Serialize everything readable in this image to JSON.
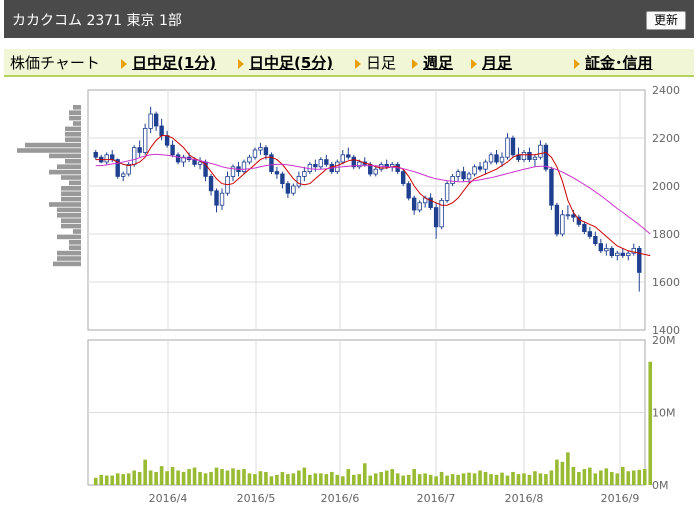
{
  "header": {
    "title": "カカクコム 2371 東京 1部",
    "update_label": "更新"
  },
  "nav": {
    "chart_label": "株価チャート",
    "items": [
      {
        "label": "日中足(1分)",
        "link": true
      },
      {
        "label": "日中足(5分)",
        "link": true
      },
      {
        "label": "日足",
        "link": false
      },
      {
        "label": "週足",
        "link": true
      },
      {
        "label": "月足",
        "link": true
      },
      {
        "label": "証金･信用",
        "link": true
      }
    ]
  },
  "chart_data": [
    {
      "type": "candlestick",
      "x_ticks": [
        "2016/4",
        "2016/5",
        "2016/6",
        "2016/7",
        "2016/8",
        "2016/9"
      ],
      "y_ticks": [
        "2400",
        "2200",
        "2000",
        "1800",
        "1600",
        "1400"
      ],
      "ylim": [
        1400,
        2400
      ],
      "grid": true,
      "colors": {
        "up": "#ffffff",
        "down": "#1f3f8f",
        "wick": "#1f3f8f",
        "ma_short": "#cc0000",
        "ma_long": "#cc33cc"
      },
      "series": [
        {
          "values": [
            [
              2140,
              2150,
              2110,
              2120
            ],
            [
              2120,
              2130,
              2095,
              2100
            ],
            [
              2100,
              2140,
              2090,
              2130
            ],
            [
              2130,
              2150,
              2100,
              2110
            ],
            [
              2110,
              2115,
              2030,
              2040
            ],
            [
              2040,
              2060,
              2020,
              2050
            ],
            [
              2050,
              2100,
              2040,
              2090
            ],
            [
              2090,
              2170,
              2080,
              2160
            ],
            [
              2160,
              2190,
              2120,
              2140
            ],
            [
              2140,
              2260,
              2130,
              2240
            ],
            [
              2240,
              2330,
              2220,
              2300
            ],
            [
              2300,
              2310,
              2230,
              2250
            ],
            [
              2250,
              2280,
              2190,
              2210
            ],
            [
              2210,
              2230,
              2160,
              2170
            ],
            [
              2170,
              2190,
              2120,
              2130
            ],
            [
              2130,
              2140,
              2090,
              2100
            ],
            [
              2100,
              2130,
              2080,
              2120
            ],
            [
              2120,
              2140,
              2100,
              2110
            ],
            [
              2110,
              2120,
              2080,
              2090
            ],
            [
              2090,
              2120,
              2070,
              2100
            ],
            [
              2100,
              2110,
              2020,
              2040
            ],
            [
              2040,
              2050,
              1960,
              1980
            ],
            [
              1980,
              1990,
              1890,
              1920
            ],
            [
              1920,
              1990,
              1900,
              1970
            ],
            [
              1970,
              2060,
              1960,
              2040
            ],
            [
              2040,
              2090,
              2020,
              2080
            ],
            [
              2080,
              2100,
              2040,
              2060
            ],
            [
              2060,
              2110,
              2050,
              2100
            ],
            [
              2100,
              2130,
              2090,
              2120
            ],
            [
              2120,
              2160,
              2110,
              2150
            ],
            [
              2150,
              2180,
              2130,
              2160
            ],
            [
              2160,
              2170,
              2110,
              2130
            ],
            [
              2130,
              2140,
              2050,
              2060
            ],
            [
              2060,
              2080,
              2030,
              2050
            ],
            [
              2050,
              2060,
              1990,
              2010
            ],
            [
              2010,
              2020,
              1950,
              1970
            ],
            [
              1970,
              2010,
              1960,
              2000
            ],
            [
              2000,
              2060,
              1990,
              2040
            ],
            [
              2040,
              2080,
              2020,
              2060
            ],
            [
              2060,
              2100,
              2050,
              2090
            ],
            [
              2090,
              2110,
              2060,
              2080
            ],
            [
              2080,
              2120,
              2070,
              2110
            ],
            [
              2110,
              2130,
              2080,
              2090
            ],
            [
              2090,
              2100,
              2050,
              2060
            ],
            [
              2060,
              2110,
              2050,
              2100
            ],
            [
              2100,
              2150,
              2090,
              2130
            ],
            [
              2130,
              2160,
              2110,
              2120
            ],
            [
              2120,
              2130,
              2070,
              2080
            ],
            [
              2080,
              2110,
              2070,
              2100
            ],
            [
              2100,
              2120,
              2080,
              2090
            ],
            [
              2090,
              2100,
              2040,
              2050
            ],
            [
              2050,
              2080,
              2040,
              2070
            ],
            [
              2070,
              2100,
              2060,
              2090
            ],
            [
              2090,
              2110,
              2070,
              2080
            ],
            [
              2080,
              2100,
              2060,
              2090
            ],
            [
              2090,
              2100,
              2050,
              2060
            ],
            [
              2060,
              2070,
              2000,
              2010
            ],
            [
              2010,
              2020,
              1940,
              1950
            ],
            [
              1950,
              1960,
              1880,
              1900
            ],
            [
              1900,
              1940,
              1890,
              1930
            ],
            [
              1930,
              1960,
              1910,
              1950
            ],
            [
              1950,
              1970,
              1900,
              1910
            ],
            [
              1910,
              1930,
              1780,
              1830
            ],
            [
              1830,
              1950,
              1820,
              1940
            ],
            [
              1940,
              2020,
              1930,
              2010
            ],
            [
              2010,
              2050,
              2000,
              2040
            ],
            [
              2040,
              2070,
              2020,
              2060
            ],
            [
              2060,
              2080,
              2020,
              2030
            ],
            [
              2030,
              2060,
              2010,
              2050
            ],
            [
              2050,
              2090,
              2040,
              2080
            ],
            [
              2080,
              2100,
              2060,
              2070
            ],
            [
              2070,
              2110,
              2050,
              2100
            ],
            [
              2100,
              2140,
              2090,
              2130
            ],
            [
              2130,
              2150,
              2090,
              2100
            ],
            [
              2100,
              2140,
              2080,
              2120
            ],
            [
              2120,
              2220,
              2110,
              2200
            ],
            [
              2200,
              2210,
              2120,
              2130
            ],
            [
              2130,
              2160,
              2100,
              2110
            ],
            [
              2110,
              2150,
              2100,
              2140
            ],
            [
              2140,
              2160,
              2100,
              2110
            ],
            [
              2110,
              2130,
              2080,
              2120
            ],
            [
              2120,
              2190,
              2110,
              2170
            ],
            [
              2170,
              2180,
              2060,
              2070
            ],
            [
              2070,
              2080,
              1900,
              1920
            ],
            [
              1920,
              1930,
              1790,
              1800
            ],
            [
              1800,
              1900,
              1790,
              1880
            ],
            [
              1880,
              1920,
              1860,
              1880
            ],
            [
              1880,
              1900,
              1850,
              1870
            ],
            [
              1870,
              1880,
              1830,
              1840
            ],
            [
              1840,
              1850,
              1800,
              1810
            ],
            [
              1810,
              1830,
              1780,
              1790
            ],
            [
              1790,
              1810,
              1750,
              1760
            ],
            [
              1760,
              1780,
              1720,
              1730
            ],
            [
              1730,
              1760,
              1710,
              1740
            ],
            [
              1740,
              1750,
              1700,
              1710
            ],
            [
              1710,
              1730,
              1690,
              1720
            ],
            [
              1720,
              1740,
              1700,
              1710
            ],
            [
              1710,
              1730,
              1690,
              1720
            ],
            [
              1720,
              1760,
              1710,
              1740
            ],
            [
              1740,
              1750,
              1560,
              1640
            ]
          ]
        },
        {
          "name": "",
          "values": [
            2110,
            2110,
            2110,
            2110,
            2100,
            2090,
            2085,
            2090,
            2100,
            2120,
            2160,
            2190,
            2210,
            2210,
            2200,
            2180,
            2160,
            2130,
            2115,
            2105,
            2090,
            2060,
            2030,
            2010,
            2005,
            2010,
            2030,
            2050,
            2070,
            2090,
            2110,
            2120,
            2120,
            2110,
            2090,
            2060,
            2030,
            2010,
            2005,
            2010,
            2030,
            2050,
            2070,
            2080,
            2085,
            2095,
            2105,
            2110,
            2105,
            2095,
            2090,
            2080,
            2075,
            2075,
            2080,
            2080,
            2070,
            2040,
            2000,
            1970,
            1950,
            1940,
            1930,
            1920,
            1920,
            1930,
            1950,
            1980,
            2010,
            2030,
            2040,
            2050,
            2060,
            2070,
            2085,
            2100,
            2120,
            2130,
            2130,
            2130,
            2130,
            2135,
            2140,
            2120,
            2080,
            2020,
            1940,
            1890,
            1860,
            1850,
            1840,
            1830,
            1810,
            1790,
            1770,
            1750,
            1740,
            1730,
            1725,
            1720,
            1715,
            1710
          ]
        },
        {
          "name": "",
          "values": [
            2085,
            2085,
            2088,
            2092,
            2095,
            2100,
            2105,
            2110,
            2118,
            2125,
            2130,
            2132,
            2130,
            2128,
            2125,
            2120,
            2118,
            2115,
            2110,
            2106,
            2100,
            2094,
            2088,
            2080,
            2075,
            2072,
            2070,
            2070,
            2072,
            2075,
            2080,
            2085,
            2088,
            2090,
            2090,
            2088,
            2084,
            2080,
            2076,
            2072,
            2070,
            2070,
            2072,
            2075,
            2078,
            2080,
            2082,
            2084,
            2085,
            2085,
            2085,
            2084,
            2082,
            2080,
            2078,
            2076,
            2072,
            2066,
            2060,
            2052,
            2044,
            2036,
            2030,
            2026,
            2022,
            2020,
            2018,
            2018,
            2020,
            2022,
            2026,
            2030,
            2034,
            2040,
            2046,
            2052,
            2058,
            2064,
            2070,
            2075,
            2080,
            2082,
            2082,
            2076,
            2068,
            2058,
            2046,
            2034,
            2020,
            2006,
            1992,
            1976,
            1960,
            1942,
            1924,
            1906,
            1890,
            1872,
            1856,
            1838,
            1820,
            1800
          ]
        }
      ]
    },
    {
      "type": "bar",
      "y_ticks": [
        "20M",
        "10M",
        "0M"
      ],
      "ylim": [
        0,
        20
      ],
      "color": "#99bb33",
      "values": [
        1.0,
        1.4,
        1.3,
        1.3,
        1.6,
        1.5,
        1.6,
        2.0,
        1.8,
        3.5,
        2.0,
        1.8,
        2.6,
        1.9,
        2.5,
        2.0,
        1.8,
        2.2,
        2.4,
        1.8,
        1.6,
        1.8,
        2.4,
        2.2,
        2.0,
        2.3,
        2.1,
        2.2,
        1.6,
        1.5,
        1.9,
        1.8,
        1.2,
        1.4,
        1.8,
        1.5,
        1.6,
        2.0,
        2.4,
        1.4,
        1.6,
        1.6,
        1.5,
        1.8,
        1.4,
        1.2,
        2.2,
        1.4,
        1.5,
        3.0,
        1.3,
        1.6,
        1.8,
        2.0,
        2.2,
        1.6,
        1.3,
        1.4,
        2.2,
        1.5,
        1.6,
        1.4,
        1.2,
        1.8,
        1.3,
        1.5,
        1.4,
        1.6,
        1.7,
        1.6,
        2.0,
        1.8,
        1.5,
        1.4,
        1.7,
        1.3,
        1.8,
        1.5,
        1.6,
        1.4,
        1.9,
        1.6,
        1.5,
        2.0,
        3.5,
        3.2,
        4.5,
        2.5,
        1.8,
        2.2,
        2.4,
        1.6,
        2.0,
        2.3,
        1.8,
        1.6,
        2.5,
        1.9,
        2.0,
        2.1,
        2.2,
        17.0
      ]
    },
    {
      "type": "bar",
      "note": "volume-by-price",
      "orientation": "horizontal",
      "values": [
        2,
        3,
        3,
        2,
        4,
        4,
        4,
        14,
        16,
        8,
        4,
        6,
        8,
        5,
        3,
        5,
        5,
        5,
        8,
        6,
        6,
        5,
        5,
        2,
        6,
        3,
        3,
        6,
        6,
        7
      ]
    }
  ]
}
